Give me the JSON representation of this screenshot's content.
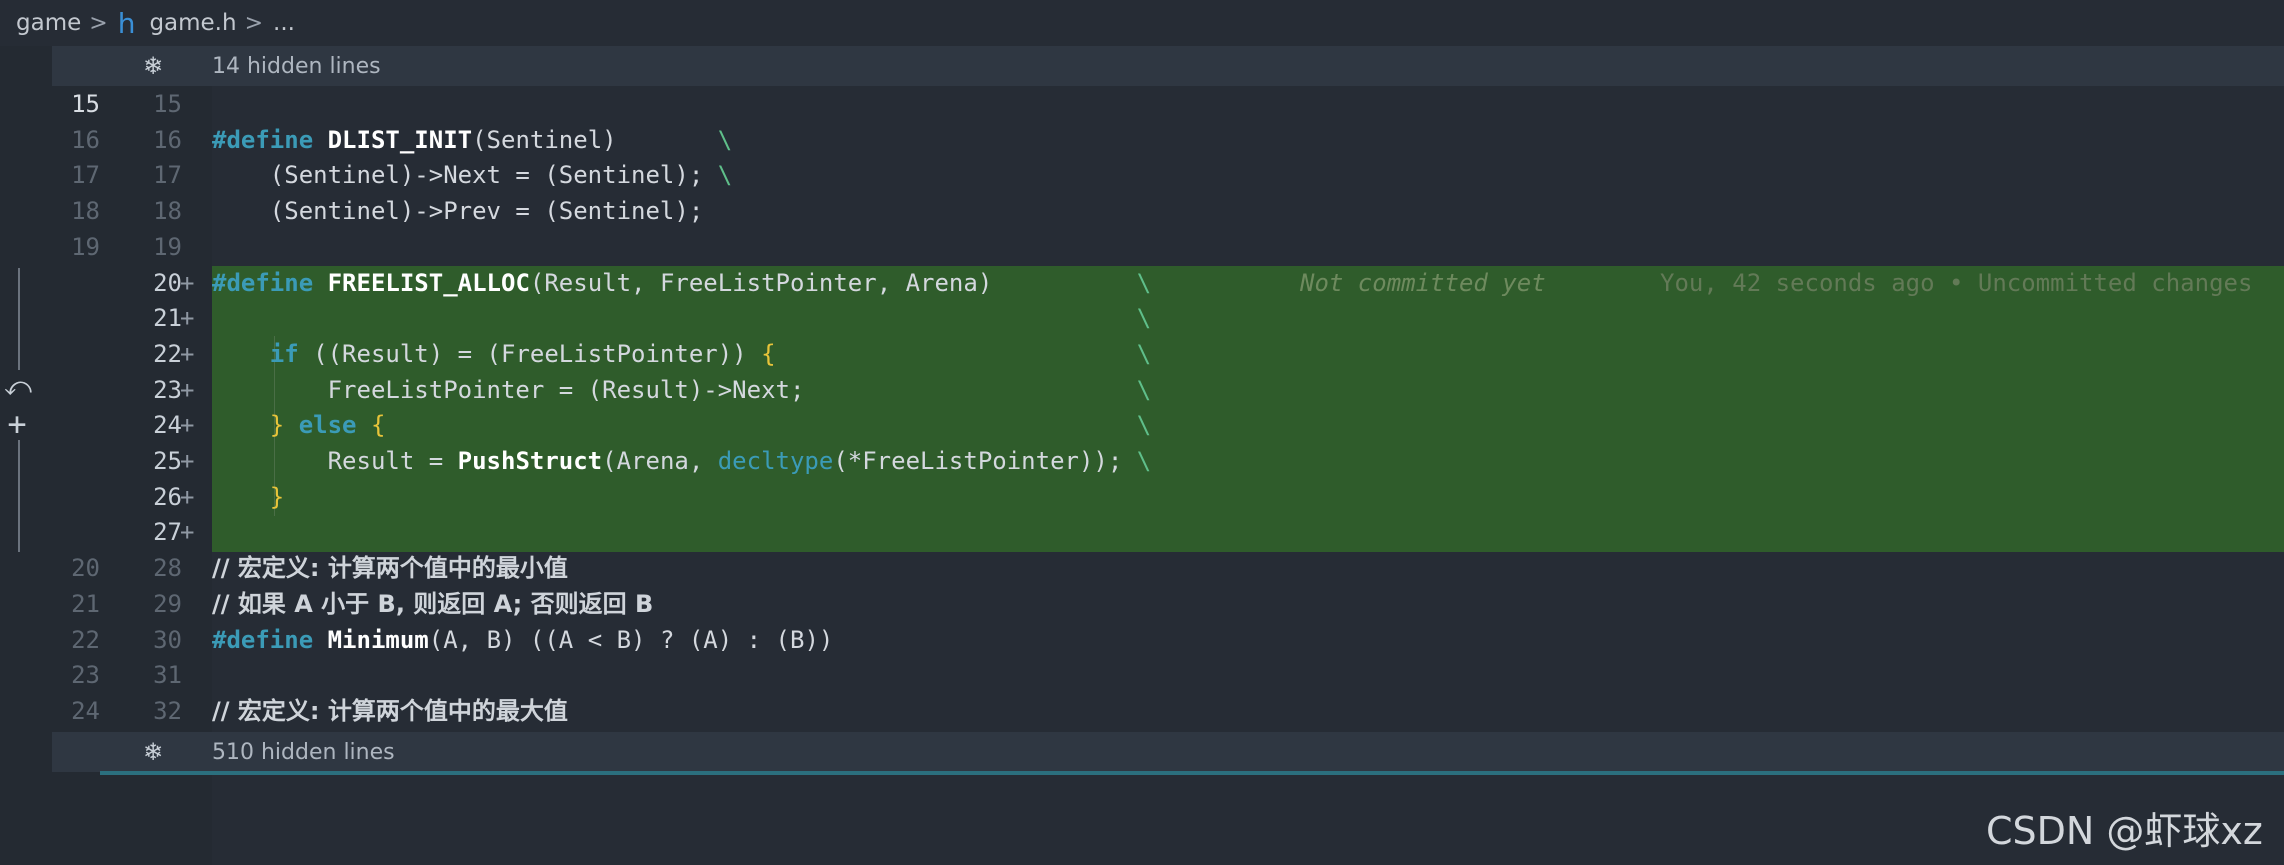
{
  "breadcrumb": {
    "folder": "game",
    "file_icon": "h",
    "file": "game.h",
    "more": "..."
  },
  "fold_top": {
    "icon": "fold-icon",
    "label": "14 hidden lines"
  },
  "fold_bottom": {
    "icon": "fold-icon",
    "label": "510 hidden lines"
  },
  "lines": [
    {
      "old": "15",
      "new": "15",
      "text": ""
    },
    {
      "old": "16",
      "new": "16",
      "text": "#define DLIST_INIT(Sentinel)       \\"
    },
    {
      "old": "17",
      "new": "17",
      "text": "    (Sentinel)->Next = (Sentinel); \\"
    },
    {
      "old": "18",
      "new": "18",
      "text": "    (Sentinel)->Prev = (Sentinel);"
    },
    {
      "old": "19",
      "new": "19",
      "text": ""
    },
    {
      "old": "",
      "new": "20",
      "added": true,
      "text": "#define FREELIST_ALLOC(Result, FreeListPointer, Arena)          \\"
    },
    {
      "old": "",
      "new": "21",
      "added": true,
      "text": "                                                                \\"
    },
    {
      "old": "",
      "new": "22",
      "added": true,
      "text": "    if ((Result) = (FreeListPointer)) {                         \\"
    },
    {
      "old": "",
      "new": "23",
      "added": true,
      "text": "        FreeListPointer = (Result)->Next;                       \\"
    },
    {
      "old": "",
      "new": "24",
      "added": true,
      "text": "    } else {                                                    \\"
    },
    {
      "old": "",
      "new": "25",
      "added": true,
      "text": "        Result = PushStruct(Arena, decltype(*FreeListPointer)); \\"
    },
    {
      "old": "",
      "new": "26",
      "added": true,
      "text": "    }"
    },
    {
      "old": "",
      "new": "27",
      "added": true,
      "text": ""
    },
    {
      "old": "20",
      "new": "28",
      "text": "// 宏定义: 计算两个值中的最小值"
    },
    {
      "old": "21",
      "new": "29",
      "text": "// 如果 A 小于 B, 则返回 A; 否则返回 B"
    },
    {
      "old": "22",
      "new": "30",
      "text": "#define Minimum(A, B) ((A < B) ? (A) : (B))"
    },
    {
      "old": "23",
      "new": "31",
      "text": ""
    },
    {
      "old": "24",
      "new": "32",
      "text": "// 宏定义: 计算两个值中的最大值"
    }
  ],
  "blame": {
    "status": "Not committed yet",
    "info": "You, 42 seconds ago • Uncommitted changes"
  },
  "added_marker": "+",
  "watermark": "CSDN @虾球xz",
  "colors": {
    "background": "#262c35",
    "added_line": "#2f5c2b",
    "keyword": "#3b9bb7",
    "paren": "#e8c43a",
    "fold_bar": "#2f3742"
  }
}
